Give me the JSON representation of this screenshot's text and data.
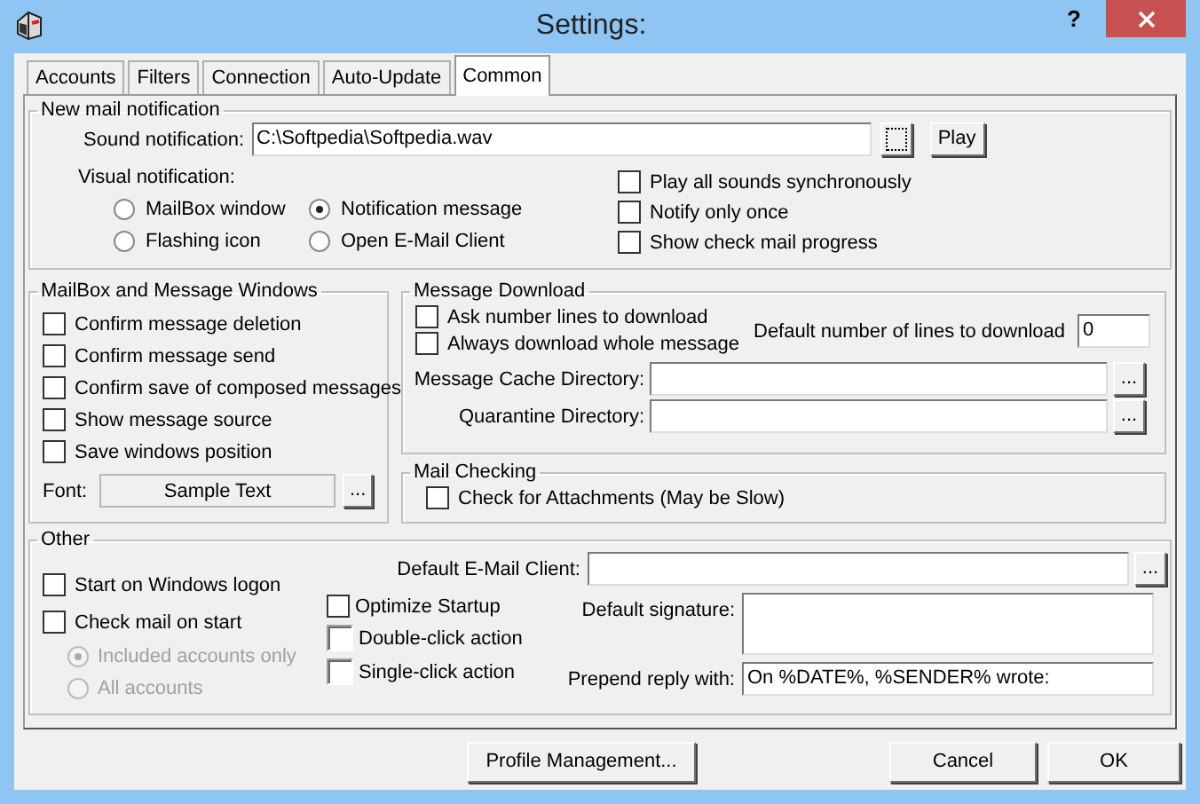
{
  "window": {
    "title": "Settings:",
    "help": "?"
  },
  "tabs": [
    {
      "label": "Accounts",
      "selected": false
    },
    {
      "label": "Filters",
      "selected": false
    },
    {
      "label": "Connection",
      "selected": false
    },
    {
      "label": "Auto-Update",
      "selected": false
    },
    {
      "label": "Common",
      "selected": true
    }
  ],
  "new_mail": {
    "title": "New mail notification",
    "sound_label": "Sound notification:",
    "sound_file": "C:\\Softpedia\\Softpedia.wav",
    "play": "Play",
    "visual_label": "Visual notification:",
    "radios": [
      {
        "label": "MailBox window",
        "selected": false
      },
      {
        "label": "Notification message",
        "selected": true
      },
      {
        "label": "Flashing icon",
        "selected": false
      },
      {
        "label": "Open E-Mail Client",
        "selected": false
      }
    ],
    "checkboxes": [
      {
        "label": "Play all sounds synchronously",
        "checked": false
      },
      {
        "label": "Notify only once",
        "checked": false
      },
      {
        "label": "Show check mail progress",
        "checked": false
      }
    ]
  },
  "mailbox": {
    "title": "MailBox and Message Windows",
    "checkboxes": [
      {
        "label": "Confirm message deletion",
        "checked": false
      },
      {
        "label": "Confirm message send",
        "checked": false
      },
      {
        "label": "Confirm save of composed messages",
        "checked": false
      },
      {
        "label": "Show message source",
        "checked": false
      },
      {
        "label": "Save windows position",
        "checked": false
      }
    ],
    "font_label": "Font:",
    "font_sample": "Sample Text",
    "font_button": "..."
  },
  "message_download": {
    "title": "Message Download",
    "checkboxes": [
      {
        "label": "Ask number lines to download",
        "checked": false
      },
      {
        "label": "Always download whole message",
        "checked": false
      }
    ],
    "lines_label": "Default number of lines to download",
    "lines_value": "0",
    "directories": [
      {
        "label": "Message Cache Directory:",
        "button": "..."
      },
      {
        "label": "Quarantine Directory:",
        "button": "..."
      }
    ]
  },
  "mail_checking": {
    "title": "Mail Checking",
    "checkboxes": [
      {
        "label": "Check for Attachments (May be Slow)",
        "checked": false
      }
    ]
  },
  "other": {
    "title": "Other",
    "checkboxes": [
      {
        "label": "Start on Windows logon",
        "checked": false
      },
      {
        "label": "Check mail on start",
        "checked": false
      }
    ],
    "radios": [
      {
        "label": "Included accounts only",
        "selected": true,
        "disabled": true
      },
      {
        "label": "All accounts",
        "selected": false,
        "disabled": true
      }
    ],
    "options": [
      {
        "label": "Optimize Startup",
        "checked": false,
        "kind": "flat"
      },
      {
        "label": "Double-click action",
        "checked": false,
        "kind": "bevel"
      },
      {
        "label": "Single-click action",
        "checked": false,
        "kind": "bevel"
      }
    ],
    "email_client_label": "Default E-Mail Client:",
    "email_client_button": "...",
    "signature_label": "Default signature:",
    "prepend_label": "Prepend reply with:",
    "prepend_value": "On %DATE%, %SENDER% wrote:"
  },
  "buttons": [
    {
      "label": "Profile Management..."
    },
    {
      "label": "Cancel"
    },
    {
      "label": "OK"
    }
  ]
}
